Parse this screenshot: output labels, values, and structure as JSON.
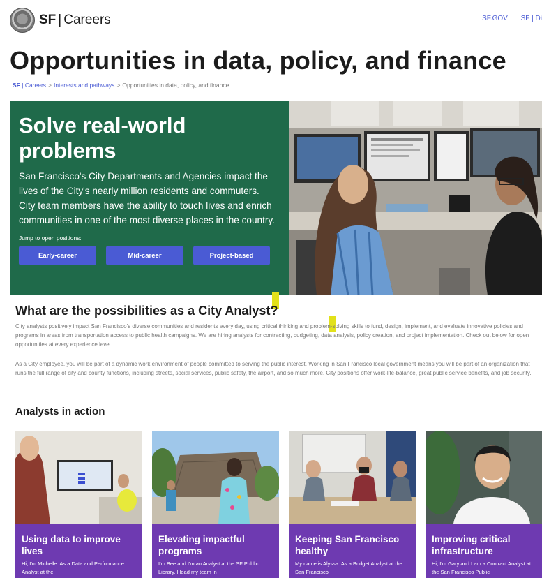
{
  "header": {
    "brand_sf": "SF",
    "brand_sep": "|",
    "brand_name": "Careers",
    "links": [
      "SF.GOV",
      "SF | Di"
    ]
  },
  "page_title": "Opportunities in data, policy, and finance",
  "breadcrumb": {
    "home_sf": "SF",
    "home_name": "Careers",
    "items": [
      "Interests and pathways",
      "Opportunities in data, policy, and finance"
    ],
    "separator": ">"
  },
  "hero": {
    "title": "Solve real-world problems",
    "text": "San Francisco's City Departments and Agencies impact the lives of the City's nearly million residents and commuters. City team members have the ability to touch lives and enrich communities in one of the most diverse places in the country.",
    "jump_label": "Jump to open positions:",
    "buttons": [
      "Early-career",
      "Mid-career",
      "Project-based"
    ]
  },
  "possibilities": {
    "title": "What are the possibilities as a City Analyst?",
    "para1": "City analysts positively impact San Francisco's diverse communities and residents every day, using critical thinking and problem-solving skills to fund, design, implement, and evaluate innovative policies and programs in areas from transportation access to public health campaigns. We are hiring analysts for contracting, budgeting, data analysis, policy creation, and project implementation. Check out below for open opportunities at every experience level.",
    "para2": "As a City employee, you will be part of a dynamic work environment of people committed to serving the public interest. Working in San Francisco local government means you will be part of an organization that runs the full range of city and county functions, including streets, social services, public safety, the airport, and so much more. City positions offer work-life-balance, great public service benefits, and job security."
  },
  "analysts": {
    "title": "Analysts in action",
    "cards": [
      {
        "title": "Using data to improve lives",
        "text": "Hi, I'm Michelle. As a Data and Performance Analyst at the"
      },
      {
        "title": "Elevating impactful programs",
        "text": "I'm Bee and I'm an Analyst at the SF Public Library. I lead my team in"
      },
      {
        "title": "Keeping San Francisco healthy",
        "text": "My name is Alyssa. As a Budget Analyst at the San Francisco"
      },
      {
        "title": "Improving critical infrastructure",
        "text": "Hi, I'm Gary and I am a Contract Analyst at the San Francisco Public"
      }
    ]
  },
  "colors": {
    "hero_green": "#1f6a4a",
    "button_blue": "#4a5bd4",
    "card_purple": "#6e3ab1",
    "highlight_yellow": "#e2e11a"
  }
}
